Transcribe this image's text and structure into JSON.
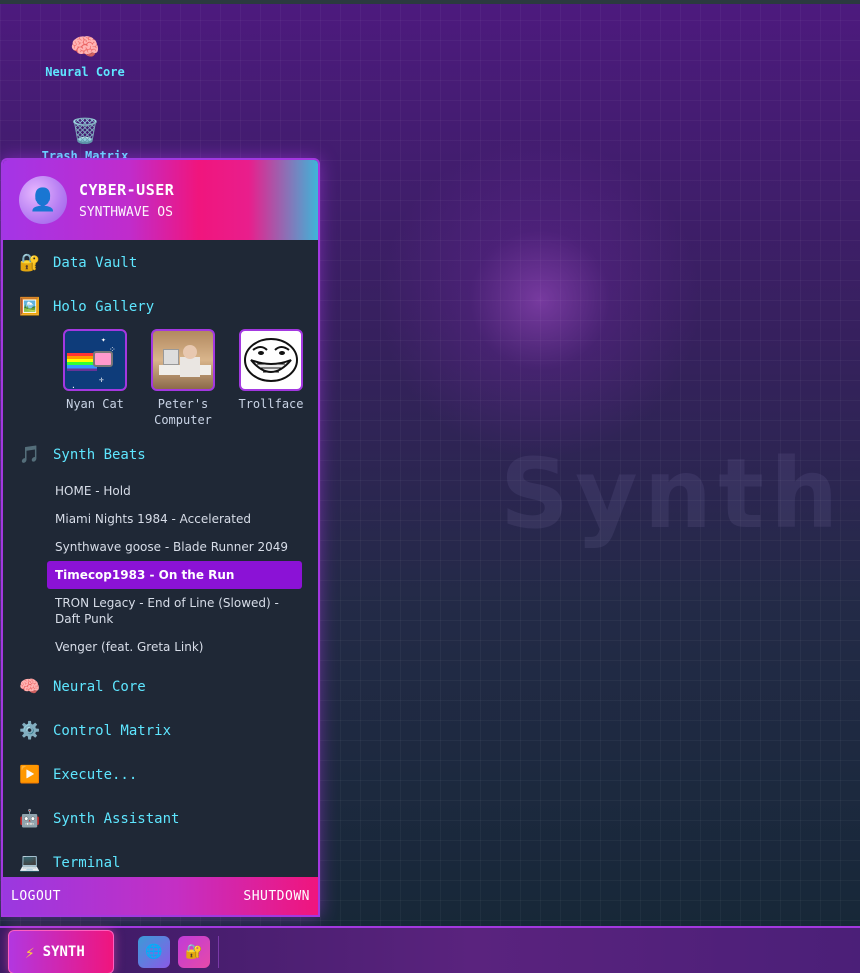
{
  "desktop": {
    "watermark": "Synth",
    "icons": [
      {
        "label": "Neural Core",
        "glyph": "🧠",
        "icon": "brain-icon"
      },
      {
        "label": "Trash Matrix",
        "glyph": "🗑️",
        "icon": "trash-icon"
      }
    ]
  },
  "menu": {
    "user_name": "CYBER-USER",
    "user_sub": "SYNTHWAVE OS",
    "avatar_glyph": "👤",
    "items": {
      "data_vault": {
        "label": "Data Vault",
        "glyph": "🔐"
      },
      "holo_gallery": {
        "label": "Holo Gallery",
        "glyph": "🖼️"
      },
      "synth_beats": {
        "label": "Synth Beats",
        "glyph": "🎵"
      },
      "neural_core": {
        "label": "Neural Core",
        "glyph": "🧠"
      },
      "control_matrix": {
        "label": "Control Matrix",
        "glyph": "⚙️"
      },
      "execute": {
        "label": "Execute...",
        "glyph": "▶️"
      },
      "synth_assistant": {
        "label": "Synth Assistant",
        "glyph": "🤖"
      },
      "terminal": {
        "label": "Terminal",
        "glyph": "💻"
      }
    },
    "gallery": [
      {
        "caption": "Nyan Cat"
      },
      {
        "caption": "Peter's Computer"
      },
      {
        "caption": "Trollface",
        "glyph": "😆"
      }
    ],
    "tracks": [
      "HOME - Hold",
      "Miami Nights 1984 - Accelerated",
      "Synthwave goose - Blade Runner 2049",
      "Timecop1983 - On the Run",
      "TRON Legacy - End of Line (Slowed) - Daft Punk",
      "Venger (feat. Greta Link)"
    ],
    "active_track_index": 3,
    "footer": {
      "logout": "LOGOUT",
      "shutdown": "SHUTDOWN"
    }
  },
  "taskbar": {
    "start_label": "SYNTH",
    "start_glyph": "⚡",
    "tray": [
      {
        "glyph": "🌐",
        "icon": "globe-icon"
      },
      {
        "glyph": "🔐",
        "icon": "lock-icon"
      }
    ]
  },
  "colors": {
    "accent": "#a338e0",
    "cyan_text": "#5ee6ff",
    "pink": "#f0157d",
    "active_track": "#8b12d6"
  }
}
